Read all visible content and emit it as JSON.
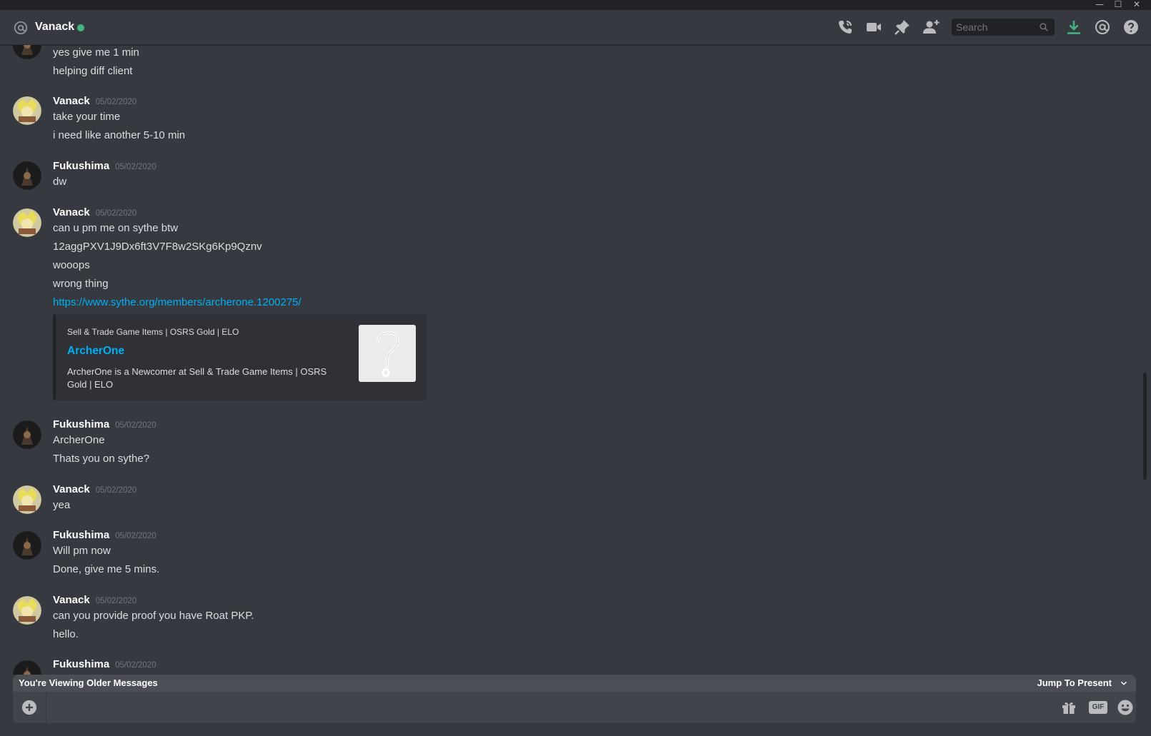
{
  "window": {
    "minimize_label": "—",
    "maximize_label": "☐",
    "close_label": "✕"
  },
  "header": {
    "username": "Vanack",
    "status_color": "#43b581",
    "icons": [
      "at-icon",
      "phone-call-icon",
      "video-icon",
      "pin-icon",
      "add-friend-icon",
      "search-icon",
      "download-icon",
      "mention-icon",
      "help-icon"
    ],
    "search_placeholder": "Search"
  },
  "messages": [
    {
      "author": "",
      "timestamp": "",
      "lines": [
        "yes give me 1 min",
        "helping diff client"
      ]
    },
    {
      "author": "Vanack",
      "timestamp": "05/02/2020",
      "lines": [
        "take your time",
        "i need like another 5-10 min"
      ]
    },
    {
      "author": "Fukushima",
      "timestamp": "05/02/2020",
      "lines": [
        "dw"
      ]
    },
    {
      "author": "Vanack",
      "timestamp": "05/02/2020",
      "lines": [
        "can u pm me on sythe btw",
        "12aggPXV1J9Dx6ft3V7F8w2SKg6Kp9Qznv",
        "wooops",
        "wrong thing"
      ],
      "link": "https://www.sythe.org/members/archerone.1200275/",
      "embed": {
        "provider": "Sell & Trade Game Items | OSRS Gold | ELO",
        "title": "ArcherOne",
        "description": "ArcherOne is a Newcomer at Sell & Trade Game Items | OSRS Gold | ELO"
      }
    },
    {
      "author": "Fukushima",
      "timestamp": "05/02/2020",
      "lines": [
        "ArcherOne",
        "Thats you on sythe?"
      ]
    },
    {
      "author": "Vanack",
      "timestamp": "05/02/2020",
      "lines": [
        "yea"
      ]
    },
    {
      "author": "Fukushima",
      "timestamp": "05/02/2020",
      "lines": [
        "Will pm now",
        "Done, give me 5 mins."
      ]
    },
    {
      "author": "Vanack",
      "timestamp": "05/02/2020",
      "lines": [
        "can you provide proof you have Roat PKP.",
        "hello."
      ]
    },
    {
      "author": "Fukushima",
      "timestamp": "05/02/2020",
      "lines": []
    }
  ],
  "older_bar": {
    "text": "You're Viewing Older Messages",
    "jump_label": "Jump To Present"
  },
  "composer": {
    "value": "",
    "gif_label": "GIF"
  },
  "colors": {
    "background": "#36393f",
    "link": "#00b0f4",
    "composer": "#40444b",
    "titlebar": "#202225"
  }
}
